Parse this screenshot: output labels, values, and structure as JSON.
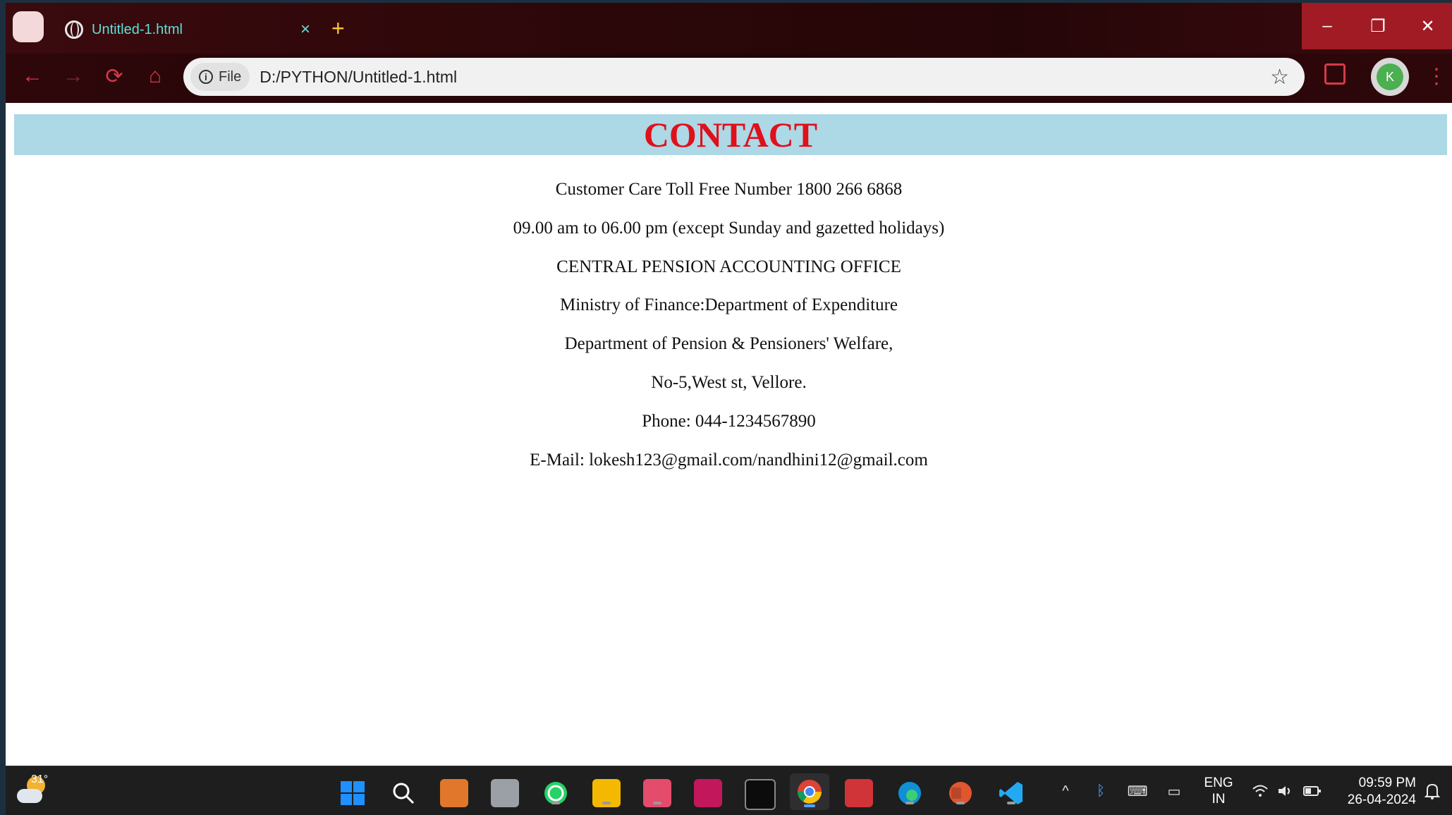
{
  "browser": {
    "tab_title": "Untitled-1.html",
    "tab_close": "×",
    "new_tab": "+",
    "window_controls": {
      "minimize": "–",
      "restore": "❐",
      "close": "✕"
    },
    "nav": {
      "back": "←",
      "forward": "→",
      "reload": "⟳",
      "home": "⌂"
    },
    "site_chip_label": "File",
    "site_chip_icon": "i",
    "url": "D:/PYTHON/Untitled-1.html",
    "bookmark_star": "☆",
    "profile_initial": "K",
    "menu": "⋮"
  },
  "page": {
    "title": "CONTACT",
    "lines": [
      "Customer Care Toll Free Number 1800 266 6868",
      "09.00 am to 06.00 pm (except Sunday and gazetted holidays)",
      "CENTRAL PENSION ACCOUNTING OFFICE",
      "Ministry of Finance:Department of Expenditure",
      "Department of Pension & Pensioners' Welfare,",
      "No-5,West st, Vellore.",
      "Phone: 044-1234567890",
      "E-Mail: lokesh123@gmail.com/nandhini12@gmail.com"
    ],
    "colors": {
      "header_bg": "#add8e6",
      "title": "#e0101a"
    }
  },
  "taskbar": {
    "weather_temp": "31°",
    "language": "ENG",
    "region": "IN",
    "time": "09:59 PM",
    "date": "26-04-2024",
    "tray_chevron": "^"
  }
}
